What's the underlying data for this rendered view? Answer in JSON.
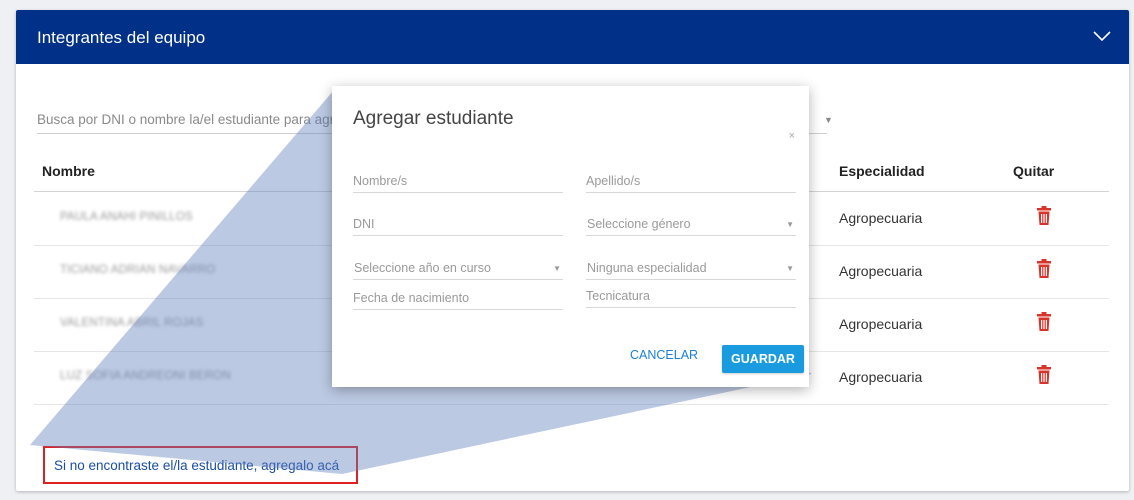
{
  "panel": {
    "title": "Integrantes del equipo",
    "collapse_icon": "chevron-down-icon",
    "header_color": "#003087"
  },
  "search": {
    "placeholder": "Busca por DNI o nombre la/el estudiante para agregarlo",
    "icon": "caret-down-icon"
  },
  "table": {
    "columns": [
      "Nombre",
      "Especialidad",
      "Quitar"
    ],
    "rows": [
      {
        "name": "PAULA ANAHI PINILLOS",
        "especialidad": "Agropecuaria"
      },
      {
        "name": "TICIANO ADRIAN NAVARRO",
        "especialidad": "Agropecuaria"
      },
      {
        "name": "VALENTINA ABRIL ROJAS",
        "especialidad": "Agropecuaria"
      },
      {
        "name": "LUZ SOFIA ANDREONI BERON",
        "especialidad": "Agropecuaria"
      }
    ],
    "remove_icon": "trash-icon",
    "remove_color": "#d9342b"
  },
  "add_link": {
    "text": "Si no encontraste el/la estudiante, agregalo acá",
    "highlight_color": "#e02020"
  },
  "modal": {
    "title": "Agregar estudiante",
    "close_label": "×",
    "fields": {
      "nombre": "Nombre/s",
      "apellido": "Apellido/s",
      "dni": "DNI",
      "genero": "Seleccione género",
      "anio": "Seleccione año en curso",
      "especialidad": "Ninguna especialidad",
      "fecha": "Fecha de nacimiento",
      "tecnicatura": "Tecnicatura"
    },
    "cancel_label": "CANCELAR",
    "save_label": "GUARDAR",
    "accent_color": "#1a9be0"
  }
}
